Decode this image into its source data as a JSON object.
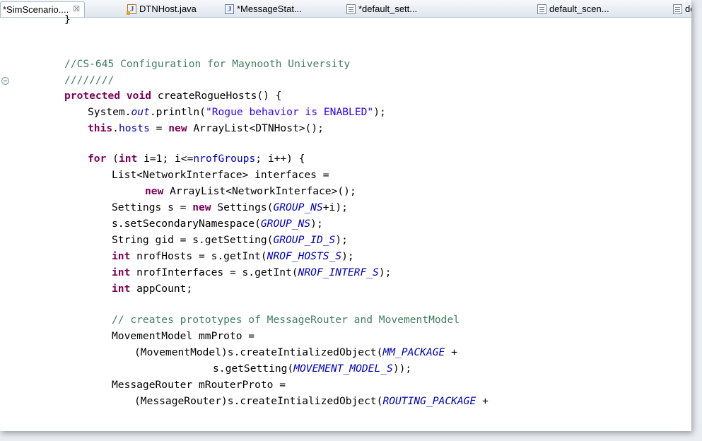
{
  "tabs": [
    {
      "label": "*SimScenario....",
      "icon": "none",
      "active": true,
      "close": "☒"
    },
    {
      "label": "DTNHost.java",
      "icon": "java-file-icon"
    },
    {
      "label": "*MessageStat...",
      "icon": "java-file-icon"
    },
    {
      "label": "*default_sett...",
      "icon": "text-file-icon"
    },
    {
      "label": "default_scen...",
      "icon": "text-file-icon"
    },
    {
      "label": "de",
      "icon": "text-file-icon"
    }
  ],
  "code": {
    "l0": {
      "a": "}"
    },
    "l1": {
      "a": "//CS-645 Configuration for Maynooth University"
    },
    "l2": {
      "a": "////////"
    },
    "l3": {
      "a": "protected",
      "b": " ",
      "c": "void",
      "d": " createRogueHosts() {"
    },
    "l4": {
      "a": "System.",
      "b": "out",
      "c": ".println(",
      "d": "\"Rogue behavior is ENABLED\"",
      "e": ");"
    },
    "l5": {
      "a": "this",
      "b": ".",
      "c": "hosts",
      "d": " = ",
      "e": "new",
      "f": " ArrayList<DTNHost>();"
    },
    "l6": {
      "a": "for",
      "b": " (",
      "c": "int",
      "d": " i=1; i<=",
      "e": "nrofGroups",
      "f": "; i++) {"
    },
    "l7": {
      "a": "List<NetworkInterface> interfaces ="
    },
    "l8": {
      "a": "new",
      "b": " ArrayList<NetworkInterface>();"
    },
    "l9": {
      "a": "Settings s = ",
      "b": "new",
      "c": " Settings(",
      "d": "GROUP_NS",
      "e": "+i);"
    },
    "l10": {
      "a": "s.setSecondaryNamespace(",
      "b": "GROUP_NS",
      "c": ");"
    },
    "l11": {
      "a": "String gid = s.getSetting(",
      "b": "GROUP_ID_S",
      "c": ");"
    },
    "l12": {
      "a": "int",
      "b": " nrofHosts = s.getInt(",
      "c": "NROF_HOSTS_S",
      "d": ");"
    },
    "l13": {
      "a": "int",
      "b": " nrofInterfaces = s.getInt(",
      "c": "NROF_INTERF_S",
      "d": ");"
    },
    "l14": {
      "a": "int",
      "b": " appCount;"
    },
    "l15": {
      "a": "// creates prototypes of MessageRouter and MovementModel"
    },
    "l16": {
      "a": "MovementModel mmProto ="
    },
    "l17": {
      "a": "(MovementModel)s.createIntializedObject(",
      "b": "MM_PACKAGE",
      "c": " +"
    },
    "l18": {
      "a": "s.getSetting(",
      "b": "MOVEMENT_MODEL_S",
      "c": "));"
    },
    "l19": {
      "a": "MessageRouter mRouterProto ="
    },
    "l20": {
      "a": "(MessageRouter)s.createIntializedObject(",
      "b": "ROUTING_PACKAGE",
      "c": " +"
    }
  }
}
